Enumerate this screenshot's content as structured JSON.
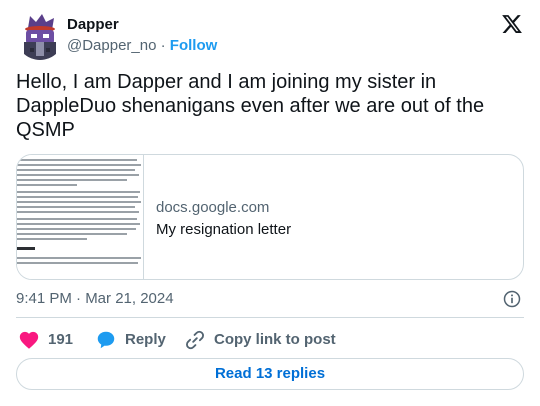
{
  "author": {
    "display_name": "Dapper",
    "handle": "@Dapper_no",
    "separator": "·",
    "follow_label": "Follow",
    "avatar": "avatar-image"
  },
  "platform_icon": "x-logo-icon",
  "tweet": {
    "text": "Hello, I am Dapper and I am joining my sister in DappleDuo shenanigans even after we are out of the QSMP"
  },
  "link_card": {
    "domain": "docs.google.com",
    "title": "My resignation letter",
    "thumbnail": "document-preview"
  },
  "timestamp": "9:41 PM · Mar 21, 2024",
  "info_icon": "info-icon",
  "actions": {
    "like_count": "191",
    "reply_label": "Reply",
    "copy_link_label": "Copy link to post",
    "like_color": "#f91880",
    "reply_color": "#1d9bf0"
  },
  "read_replies_label": "Read 13 replies",
  "colors": {
    "text": "#0f1419",
    "secondary": "#536471",
    "accent": "#1d9bf0",
    "link": "#006fd6",
    "border": "#cfd9de"
  }
}
